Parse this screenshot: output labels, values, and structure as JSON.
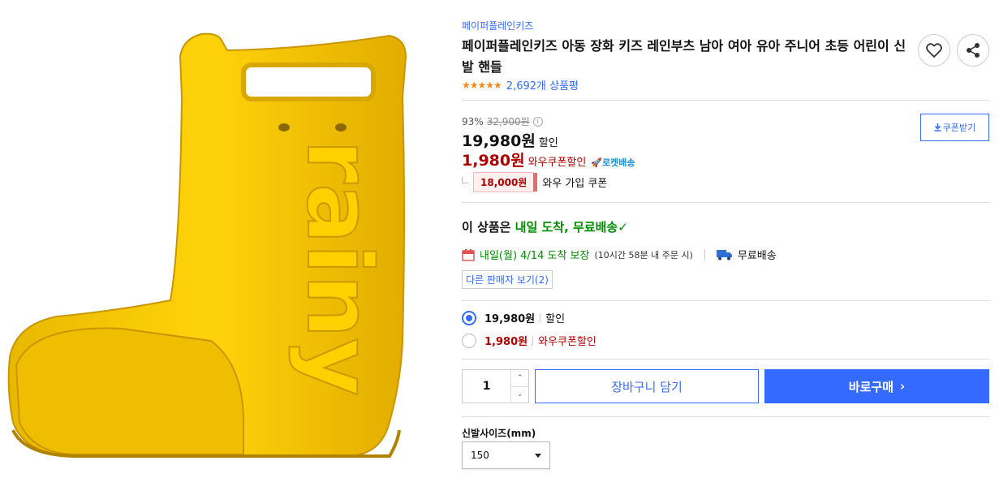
{
  "product": {
    "brand": "페이퍼플레인키즈",
    "title": "페이퍼플레인키즈 아동 장화 키즈 레인부츠 남아 여아 유아 주니어 초등 어린이 신발 핸들",
    "stars": "★★★★★",
    "review_count": "2,692개 상품평",
    "image_text": "rainy"
  },
  "pricing": {
    "discount_rate": "93%",
    "original_price": "32,900원",
    "info_icon": "i",
    "sale_price": "19,980원",
    "sale_label": "할인",
    "wow_price": "1,980원",
    "wow_label": "와우쿠폰할인",
    "rocket_label": "로켓배송",
    "coupon_button": "쿠폰받기",
    "join_amount": "18,000원",
    "join_label": "와우 가입 쿠폰"
  },
  "delivery": {
    "headline_prefix": "이 상품은 ",
    "headline_highlight": "내일 도착, 무료배송",
    "check": "✓",
    "arrival_date": "내일(월) 4/14 도착 보장",
    "arrival_note": "(10시간 58분 내 주문 시)",
    "free_shipping": "무료배송",
    "other_sellers": "다른 판매자 보기(2)"
  },
  "options": [
    {
      "price": "19,980원",
      "label": "할인",
      "selected": true
    },
    {
      "price": "1,980원",
      "label": "와우쿠폰할인",
      "selected": false
    }
  ],
  "purchase": {
    "quantity": "1",
    "up_arrow": "⌃",
    "down_arrow": "⌄",
    "cart_button": "장바구니 담기",
    "buy_button": "바로구매",
    "buy_arrow": "›"
  },
  "size": {
    "label": "신발사이즈(mm)",
    "selected": "150"
  },
  "icons": {
    "favorite": "heart-icon",
    "share": "share-icon",
    "calendar": "calendar-icon",
    "truck": "truck-icon",
    "rocket": "rocket-icon",
    "download": "download-icon"
  },
  "colors": {
    "accent": "#346aff",
    "wow_red": "#ae0000",
    "green": "#008c00",
    "boot_yellow": "#f5c800"
  }
}
